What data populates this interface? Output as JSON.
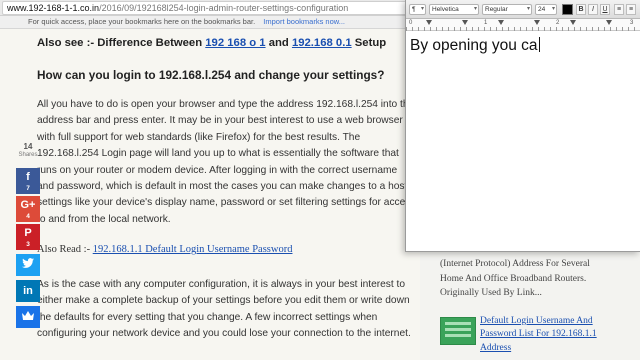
{
  "browser": {
    "url_host": "www.192-168-1-1.co.in",
    "url_path": "/2016/09/192168l254-login-admin-router-settings-configuration",
    "bookmarks_hint": "For quick access, place your bookmarks here on the bookmarks bar.",
    "import_link": "Import bookmarks now..."
  },
  "article": {
    "also_see_prefix": "Also see :- Difference Between",
    "also_see_link1": "192 168 o 1",
    "also_see_and": "and",
    "also_see_link2": "192.168 0.1",
    "also_see_suffix": "Setup",
    "heading": "How can you login to 192.168.l.254 and change your settings?",
    "paragraph1": [
      "All you have to do is open your browser and type the address 192.168.l.254 into the",
      "address bar and press enter. It may be in your best interest to use a web browser",
      "with full support for web standards (like Firefox) for the best results. The",
      "192.168.l.254 Login page will land you up to what is essentially the software that",
      "runs on your router or modem device. After logging in with the correct username",
      "and password, which is default in most the cases you can make changes to a host of",
      "settings like your device's display name, password or set filtering settings for access",
      "to and from the local network."
    ],
    "also_read_prefix": "Also Read :-",
    "also_read_link": "192.168.1.1 Default Login Username Password",
    "paragraph2": [
      "As is the case with any computer configuration, it is always in your best interest to",
      "either make a complete backup of your settings before you edit them or write down",
      "the defaults for every setting that you change. A few incorrect settings when",
      "configuring your network device and you could lose your connection to the internet."
    ]
  },
  "share": {
    "count": "14",
    "label": "Shares",
    "facebook_count": "7",
    "gplus_count": "4",
    "pinterest_count": "3",
    "colors": {
      "facebook": "#3b5998",
      "gplus": "#dd4b39",
      "pinterest": "#cb2027",
      "twitter": "#1da1f2",
      "linkedin": "#0077b5",
      "sumo": "#1a73e8"
    }
  },
  "sidebar": {
    "snippet": [
      "(Internet Protocol) Address For Several",
      "Home And Office Broadband Routers.",
      "Originally Used By Link..."
    ],
    "related_title": [
      "Default Login Username And",
      "Password List For 192.168.1.1",
      "Address"
    ]
  },
  "editor": {
    "paragraph_style": "¶",
    "font_family": "Helvetica",
    "font_style": "Regular",
    "font_size": "24",
    "text_color": "#000000",
    "bold": "B",
    "italic": "I",
    "underline": "U",
    "ruler_numbers": [
      "0",
      "1",
      "2",
      "3"
    ],
    "text": "By opening you ca"
  }
}
